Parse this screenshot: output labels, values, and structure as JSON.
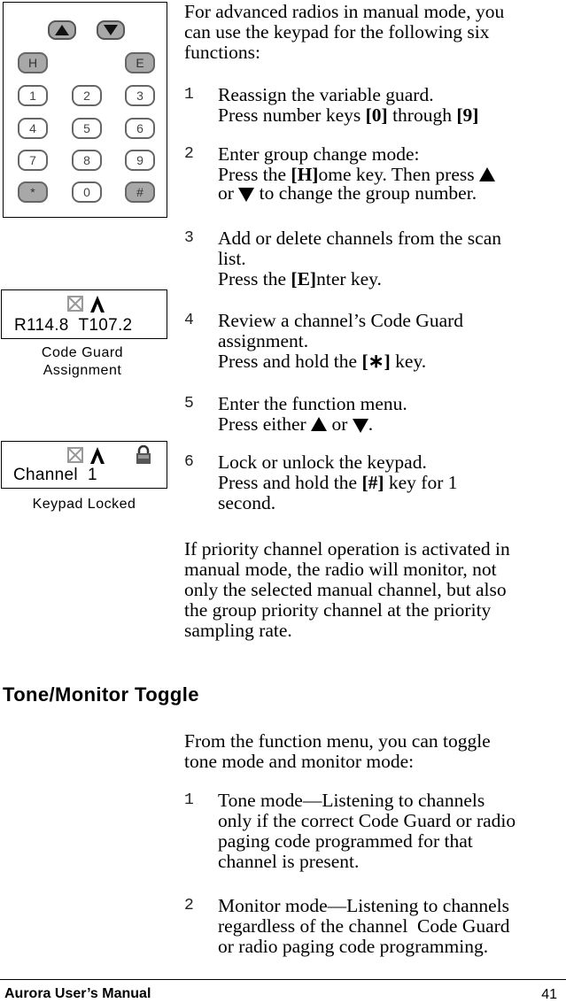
{
  "figures": {
    "keypad": {
      "arrow_keys": [
        {
          "name": "up",
          "icon": "up-arrow-icon"
        },
        {
          "name": "down",
          "icon": "down-arrow-icon"
        }
      ],
      "function_keys": [
        {
          "label": "H"
        },
        {
          "label": "E"
        }
      ],
      "number_rows": [
        [
          "1",
          "2",
          "3"
        ],
        [
          "4",
          "5",
          "6"
        ],
        [
          "7",
          "8",
          "9"
        ],
        [
          "*",
          "0",
          "#"
        ]
      ]
    },
    "code_guard_display": {
      "icons": [
        "scan-off-icon",
        "signal-icon"
      ],
      "text": "R114.8  T107.2",
      "caption_line1": "Code Guard",
      "caption_line2": "Assignment"
    },
    "keypad_locked_display": {
      "icons": [
        "scan-off-icon",
        "signal-icon",
        "lock-icon"
      ],
      "text": "Channel  1",
      "caption": "Keypad Locked"
    }
  },
  "intro": {
    "line1": "For advanced radios in manual mode, you",
    "line2": "can use the keypad for the following six",
    "line3": "functions:"
  },
  "functions": [
    {
      "num": "1",
      "title": "Reassign the variable guard.",
      "instr_pre": "Press number keys ",
      "key1": "[0]",
      "instr_mid": " through ",
      "key2": "[9]"
    },
    {
      "num": "2",
      "title": "Enter group change mode:",
      "instr_pre": "Press the ",
      "key1": "[H]",
      "instr_mid": "ome key. Then press",
      "line3_pre": "or",
      "line3_post": " to change the group number."
    },
    {
      "num": "3",
      "title_l1": "Add or delete channels from the scan",
      "title_l2": "list.",
      "instr_pre": "Press the ",
      "key1": "[E]",
      "instr_post": "nter key."
    },
    {
      "num": "4",
      "title_l1": "Review a channel’s Code Guard",
      "title_l2": "assignment.",
      "instr_pre": "Press and hold the ",
      "key1": "[∗]",
      "instr_post": " key."
    },
    {
      "num": "5",
      "title": "Enter the function menu.",
      "instr_pre": "Press either ",
      "instr_mid": " or ",
      "instr_post": "."
    },
    {
      "num": "6",
      "title": "Lock or unlock the keypad.",
      "instr_pre": "Press and hold the ",
      "key1": "[#]",
      "instr_post": " key for 1",
      "instr_l3": "second."
    }
  ],
  "priority_paragraph": {
    "line1": "If priority channel operation is activated in",
    "line2": "manual mode, the radio will monitor, not",
    "line3": "only the selected manual channel, but also",
    "line4": "the group priority channel at the priority",
    "line5": "sampling rate."
  },
  "section": {
    "heading": "Tone/Monitor Toggle",
    "intro_line1": "From the function menu, you can toggle",
    "intro_line2": "tone mode and monitor mode:",
    "items": [
      {
        "num": "1",
        "l1": "Tone mode—Listening to channels",
        "l2": "only if the correct Code Guard or radio",
        "l3": "paging code programmed for that",
        "l4": "channel is present."
      },
      {
        "num": "2",
        "l1": "Monitor mode—Listening to channels",
        "l2": "regardless of the channel  Code Guard",
        "l3": "or radio paging code programming."
      }
    ]
  },
  "footer": {
    "title": "Aurora User’s Manual",
    "page": "41"
  }
}
